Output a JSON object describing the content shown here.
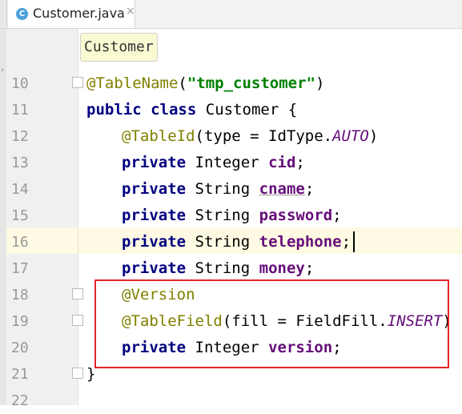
{
  "tab": {
    "icon": "c-class-icon",
    "icon_letter": "C",
    "title": "Customer.java",
    "close": "×"
  },
  "breadcrumb": "Customer",
  "lines": [
    {
      "num": "10"
    },
    {
      "num": "11"
    },
    {
      "num": "12"
    },
    {
      "num": "13"
    },
    {
      "num": "14"
    },
    {
      "num": "15"
    },
    {
      "num": "16"
    },
    {
      "num": "17"
    },
    {
      "num": "18"
    },
    {
      "num": "19"
    },
    {
      "num": "20"
    },
    {
      "num": "21"
    },
    {
      "num": "22"
    }
  ],
  "code": {
    "l10": {
      "ann": "@TableName",
      "open": "(",
      "str": "\"tmp_customer\"",
      "close": ")"
    },
    "l11": {
      "kw1": "public",
      "kw2": "class",
      "name": "Customer",
      "brace": "{"
    },
    "l12": {
      "ann": "@TableId",
      "rest1": "(type = IdType.",
      "enum": "AUTO",
      "rest2": ")"
    },
    "l13": {
      "kw": "private",
      "type": "Integer",
      "field": "cid",
      "end": ";"
    },
    "l14": {
      "kw": "private",
      "type": "String",
      "field": "cname",
      "end": ";"
    },
    "l15": {
      "kw": "private",
      "type": "String",
      "field": "password",
      "end": ";"
    },
    "l16": {
      "kw": "private",
      "type": "String",
      "field": "telephone",
      "end": ";"
    },
    "l17": {
      "kw": "private",
      "type": "String",
      "field": "money",
      "end": ";"
    },
    "l18": {
      "ann": "@Version"
    },
    "l19": {
      "ann": "@TableField",
      "rest1": "(fill = FieldFill.",
      "enum": "INSERT",
      "rest2": ")"
    },
    "l20": {
      "kw": "private",
      "type": "Integer",
      "field": "version",
      "end": ";"
    },
    "l21": {
      "brace": "}"
    }
  },
  "colors": {
    "keyword": "#000080",
    "annotation": "#808000",
    "string": "#008000",
    "field": "#660e7a",
    "highlight_border": "#e3232c",
    "current_line": "#fffae3"
  }
}
